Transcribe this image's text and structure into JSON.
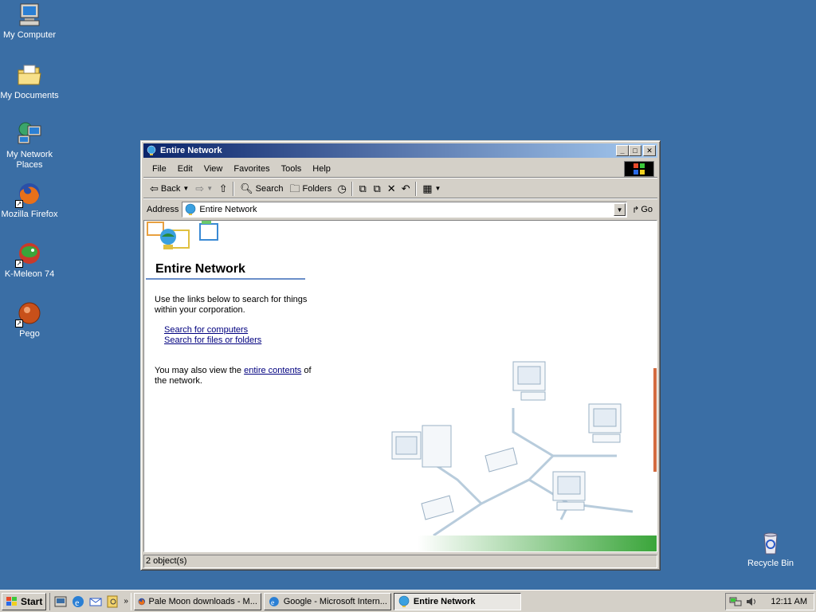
{
  "desktop": {
    "icons": [
      {
        "label": "My Computer",
        "icon": "my-computer-icon"
      },
      {
        "label": "My Documents",
        "icon": "my-documents-icon"
      },
      {
        "label": "My Network Places",
        "icon": "network-places-icon"
      },
      {
        "label": "Mozilla Firefox",
        "icon": "firefox-icon"
      },
      {
        "label": "K-Meleon 74",
        "icon": "kmeleon-icon"
      },
      {
        "label": "Pego",
        "icon": "pego-icon"
      },
      {
        "label": "Recycle Bin",
        "icon": "recycle-bin-icon"
      }
    ]
  },
  "window": {
    "title": "Entire Network",
    "menu": [
      "File",
      "Edit",
      "View",
      "Favorites",
      "Tools",
      "Help"
    ],
    "toolbar": {
      "back": "Back",
      "search": "Search",
      "folders": "Folders"
    },
    "address": {
      "label": "Address",
      "value": "Entire Network",
      "go": "Go"
    },
    "content": {
      "heading": "Entire Network",
      "intro": "Use the links below to search for things within your corporation.",
      "link_computers": "Search for computers",
      "link_files": "Search for files or folders",
      "also_prefix": "You may also view the ",
      "also_link": "entire contents",
      "also_suffix": "of the network."
    },
    "status": "2 object(s)"
  },
  "taskbar": {
    "start": "Start",
    "tasks": [
      {
        "label": "Pale Moon downloads - M...",
        "active": false
      },
      {
        "label": "Google - Microsoft Intern...",
        "active": false
      },
      {
        "label": "Entire Network",
        "active": true
      }
    ],
    "clock": "12:11 AM"
  },
  "colors": {
    "desktop": "#3a6ea5",
    "titlebar_start": "#0a246a",
    "titlebar_end": "#a6caf0",
    "link": "#00007f"
  }
}
